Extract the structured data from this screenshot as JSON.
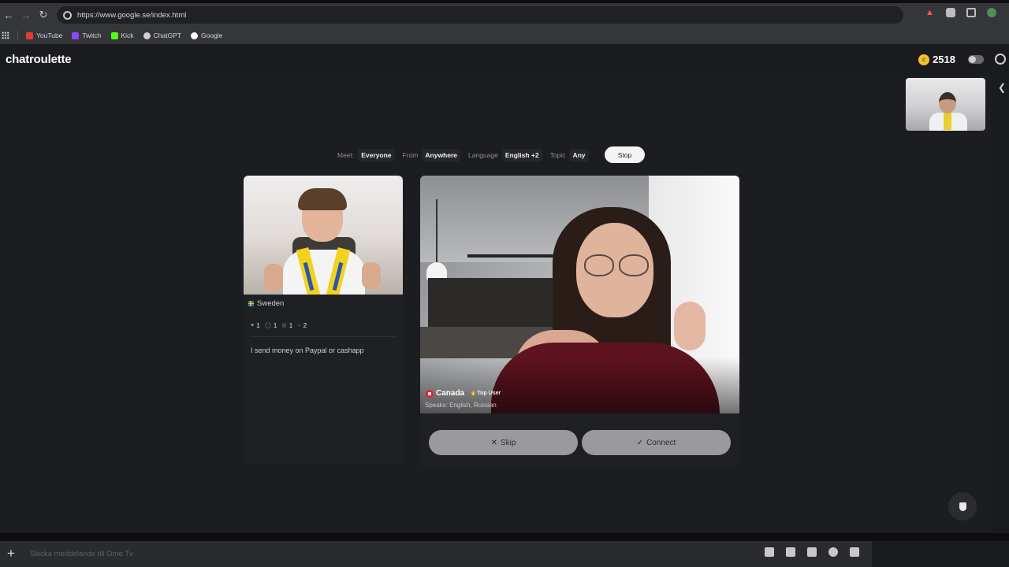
{
  "browser": {
    "url": "https://www.google.se/index.html",
    "bookmarks": [
      {
        "label": "YouTube",
        "color": "#e53935"
      },
      {
        "label": "Twitch",
        "color": "#9146ff"
      },
      {
        "label": "Kick",
        "color": "#53fc18"
      },
      {
        "label": "ChatGPT",
        "color": "#d0d0d0"
      },
      {
        "label": "Google",
        "color": "#ffffff"
      }
    ]
  },
  "header": {
    "logo": "chatroulette",
    "coins": "2518"
  },
  "filters": {
    "meet_label": "Meet:",
    "meet_value": "Everyone",
    "from_label": "From",
    "from_value": "Anywhere",
    "language_label": "Language",
    "language_value": "English +2",
    "topic_label": "Topic",
    "topic_value": "Any",
    "stop_label": "Stop"
  },
  "profile_card": {
    "country": "Sweden",
    "stats": [
      {
        "icon": "heart-icon",
        "value": "1"
      },
      {
        "icon": "like-icon",
        "value": "1"
      },
      {
        "icon": "eye-icon",
        "value": "1"
      },
      {
        "icon": "chat-icon",
        "value": "2"
      }
    ],
    "bio": "I send money on Paypal or cashapp"
  },
  "partner": {
    "country": "Canada",
    "badge": "Top User",
    "speaks": "Speaks: English, Russian"
  },
  "actions": {
    "skip_label": "Skip",
    "connect_label": "Connect"
  },
  "chat": {
    "placeholder": "Skicka meddelande till Ome Tv"
  }
}
